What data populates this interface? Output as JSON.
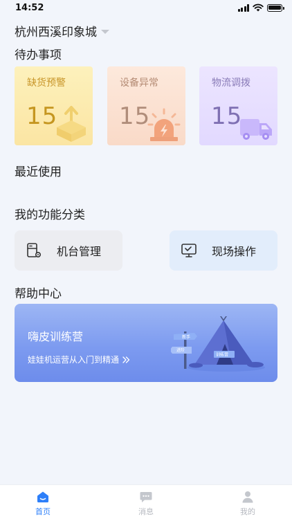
{
  "status_bar": {
    "time": "14:52"
  },
  "header": {
    "location": "杭州西溪印象城"
  },
  "todo": {
    "title": "待办事项",
    "cards": [
      {
        "label": "缺货预警",
        "count": "15"
      },
      {
        "label": "设备异常",
        "count": "15"
      },
      {
        "label": "物流调拨",
        "count": "15"
      }
    ]
  },
  "recent": {
    "title": "最近使用"
  },
  "functions": {
    "title": "我的功能分类",
    "items": [
      {
        "label": "机台管理",
        "icon": "machine-settings-icon"
      },
      {
        "label": "现场操作",
        "icon": "monitor-icon"
      }
    ]
  },
  "help": {
    "title": "帮助中心",
    "banner_title": "嗨皮训练营",
    "banner_subtitle": "娃娃机运营从入门到精通",
    "art_labels": {
      "sign_top": "新手",
      "sign_bottom": "进阶",
      "tent_flag": "训练营"
    }
  },
  "tabbar": {
    "items": [
      {
        "label": "首页",
        "icon": "home-icon",
        "active": true
      },
      {
        "label": "消息",
        "icon": "message-icon",
        "active": false
      },
      {
        "label": "我的",
        "icon": "user-icon",
        "active": false
      }
    ]
  },
  "colors": {
    "accent": "#2d7ff9",
    "background": "#f2f5fb"
  }
}
